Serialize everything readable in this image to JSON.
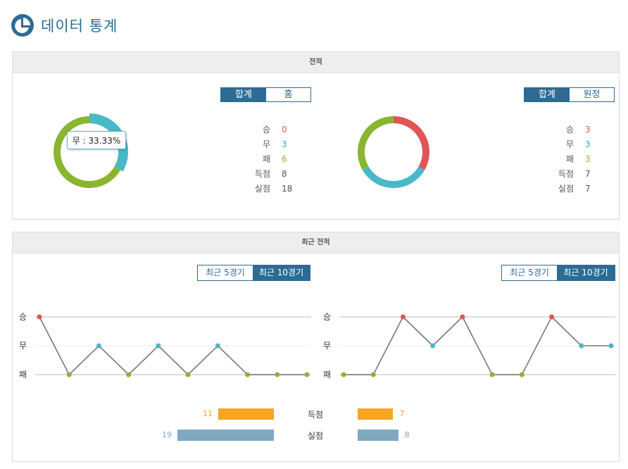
{
  "header": {
    "title": "데이터 통계",
    "icon": "pie-chart-icon"
  },
  "record_panel": {
    "title": "전적",
    "home": {
      "tabs": [
        {
          "label": "합계",
          "active": true
        },
        {
          "label": "홈",
          "active": false
        }
      ],
      "stats": [
        {
          "label": "승",
          "value": "0",
          "color": "#e05555"
        },
        {
          "label": "무",
          "value": "3",
          "color": "#3aa6c4"
        },
        {
          "label": "패",
          "value": "6",
          "color": "#8ab530"
        },
        {
          "label": "득점",
          "value": "8",
          "color": "#555555"
        },
        {
          "label": "실점",
          "value": "18",
          "color": "#555555"
        }
      ],
      "tooltip": "무 : 33.33%"
    },
    "away": {
      "tabs": [
        {
          "label": "합계",
          "active": true
        },
        {
          "label": "원정",
          "active": false
        }
      ],
      "stats": [
        {
          "label": "승",
          "value": "3",
          "color": "#e05555"
        },
        {
          "label": "무",
          "value": "3",
          "color": "#3aa6c4"
        },
        {
          "label": "패",
          "value": "3",
          "color": "#8ab530"
        },
        {
          "label": "득점",
          "value": "7",
          "color": "#555555"
        },
        {
          "label": "실점",
          "value": "7",
          "color": "#555555"
        }
      ]
    }
  },
  "recent_panel": {
    "title": "최근 전적",
    "home_tabs": [
      {
        "label": "최근 5경기",
        "active": false
      },
      {
        "label": "최근 10경기",
        "active": true
      }
    ],
    "away_tabs": [
      {
        "label": "최근 5경기",
        "active": false
      },
      {
        "label": "최근 10경기",
        "active": true
      }
    ],
    "axis_labels": [
      "승",
      "무",
      "패"
    ],
    "goals_label": "득점",
    "conceded_label": "실점",
    "home_goals": "11",
    "home_conceded": "19",
    "away_goals": "7",
    "away_conceded": "8"
  },
  "colors": {
    "win": "#e05555",
    "draw": "#48b9c7",
    "loss": "#8ab530",
    "accent": "#2d6b94",
    "goals": "#f5a623",
    "conceded": "#7fa9c0"
  },
  "chart_data": [
    {
      "type": "pie",
      "categories": [
        "승",
        "무",
        "패"
      ],
      "values": [
        0,
        3,
        6
      ],
      "colors": [
        "#e05555",
        "#48b9c7",
        "#8ab530"
      ]
    },
    {
      "type": "pie",
      "categories": [
        "승",
        "무",
        "패"
      ],
      "values": [
        3,
        3,
        3
      ],
      "colors": [
        "#e05555",
        "#48b9c7",
        "#8ab530"
      ]
    },
    {
      "type": "line",
      "y_categories": [
        "패",
        "무",
        "승"
      ],
      "values": [
        "승",
        "패",
        "무",
        "패",
        "무",
        "패",
        "무",
        "패",
        "패",
        "패"
      ]
    },
    {
      "type": "line",
      "y_categories": [
        "패",
        "무",
        "승"
      ],
      "values": [
        "패",
        "패",
        "승",
        "무",
        "승",
        "패",
        "패",
        "승",
        "무",
        "무"
      ]
    },
    {
      "type": "bar",
      "categories": [
        "득점",
        "실점"
      ],
      "series": [
        {
          "values": [
            11,
            19
          ]
        },
        {
          "values": [
            7,
            8
          ]
        }
      ]
    }
  ]
}
